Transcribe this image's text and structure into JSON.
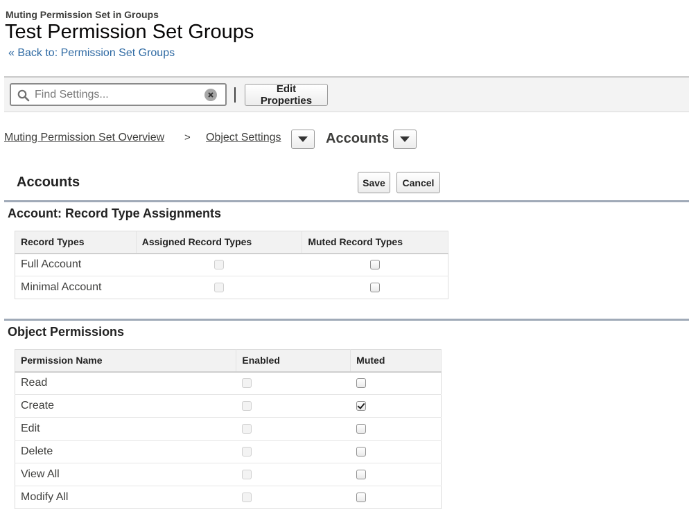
{
  "header": {
    "supertitle": "Muting Permission Set in Groups",
    "title": "Test Permission Set Groups",
    "back_link": "« Back to: Permission Set Groups"
  },
  "toolbar": {
    "search_placeholder": "Find Settings...",
    "edit_properties_label": "Edit Properties"
  },
  "breadcrumb": {
    "overview": "Muting Permission Set Overview",
    "separator": ">",
    "object_settings": "Object Settings",
    "current": "Accounts"
  },
  "section": {
    "title": "Accounts",
    "save_label": "Save",
    "cancel_label": "Cancel"
  },
  "record_types": {
    "heading": "Account: Record Type Assignments",
    "columns": [
      "Record Types",
      "Assigned Record Types",
      "Muted Record Types"
    ],
    "rows": [
      {
        "name": "Full Account",
        "assigned": false,
        "muted": false
      },
      {
        "name": "Minimal Account",
        "assigned": false,
        "muted": false
      }
    ]
  },
  "object_permissions": {
    "heading": "Object Permissions",
    "columns": [
      "Permission Name",
      "Enabled",
      "Muted"
    ],
    "rows": [
      {
        "name": "Read",
        "enabled": false,
        "muted": false
      },
      {
        "name": "Create",
        "enabled": false,
        "muted": true
      },
      {
        "name": "Edit",
        "enabled": false,
        "muted": false
      },
      {
        "name": "Delete",
        "enabled": false,
        "muted": false
      },
      {
        "name": "View All",
        "enabled": false,
        "muted": false
      },
      {
        "name": "Modify All",
        "enabled": false,
        "muted": false
      }
    ]
  },
  "colors": {
    "link": "#2f6aa3",
    "divider": "#a0aab8",
    "toolbar_bg": "#f3f3f3"
  }
}
